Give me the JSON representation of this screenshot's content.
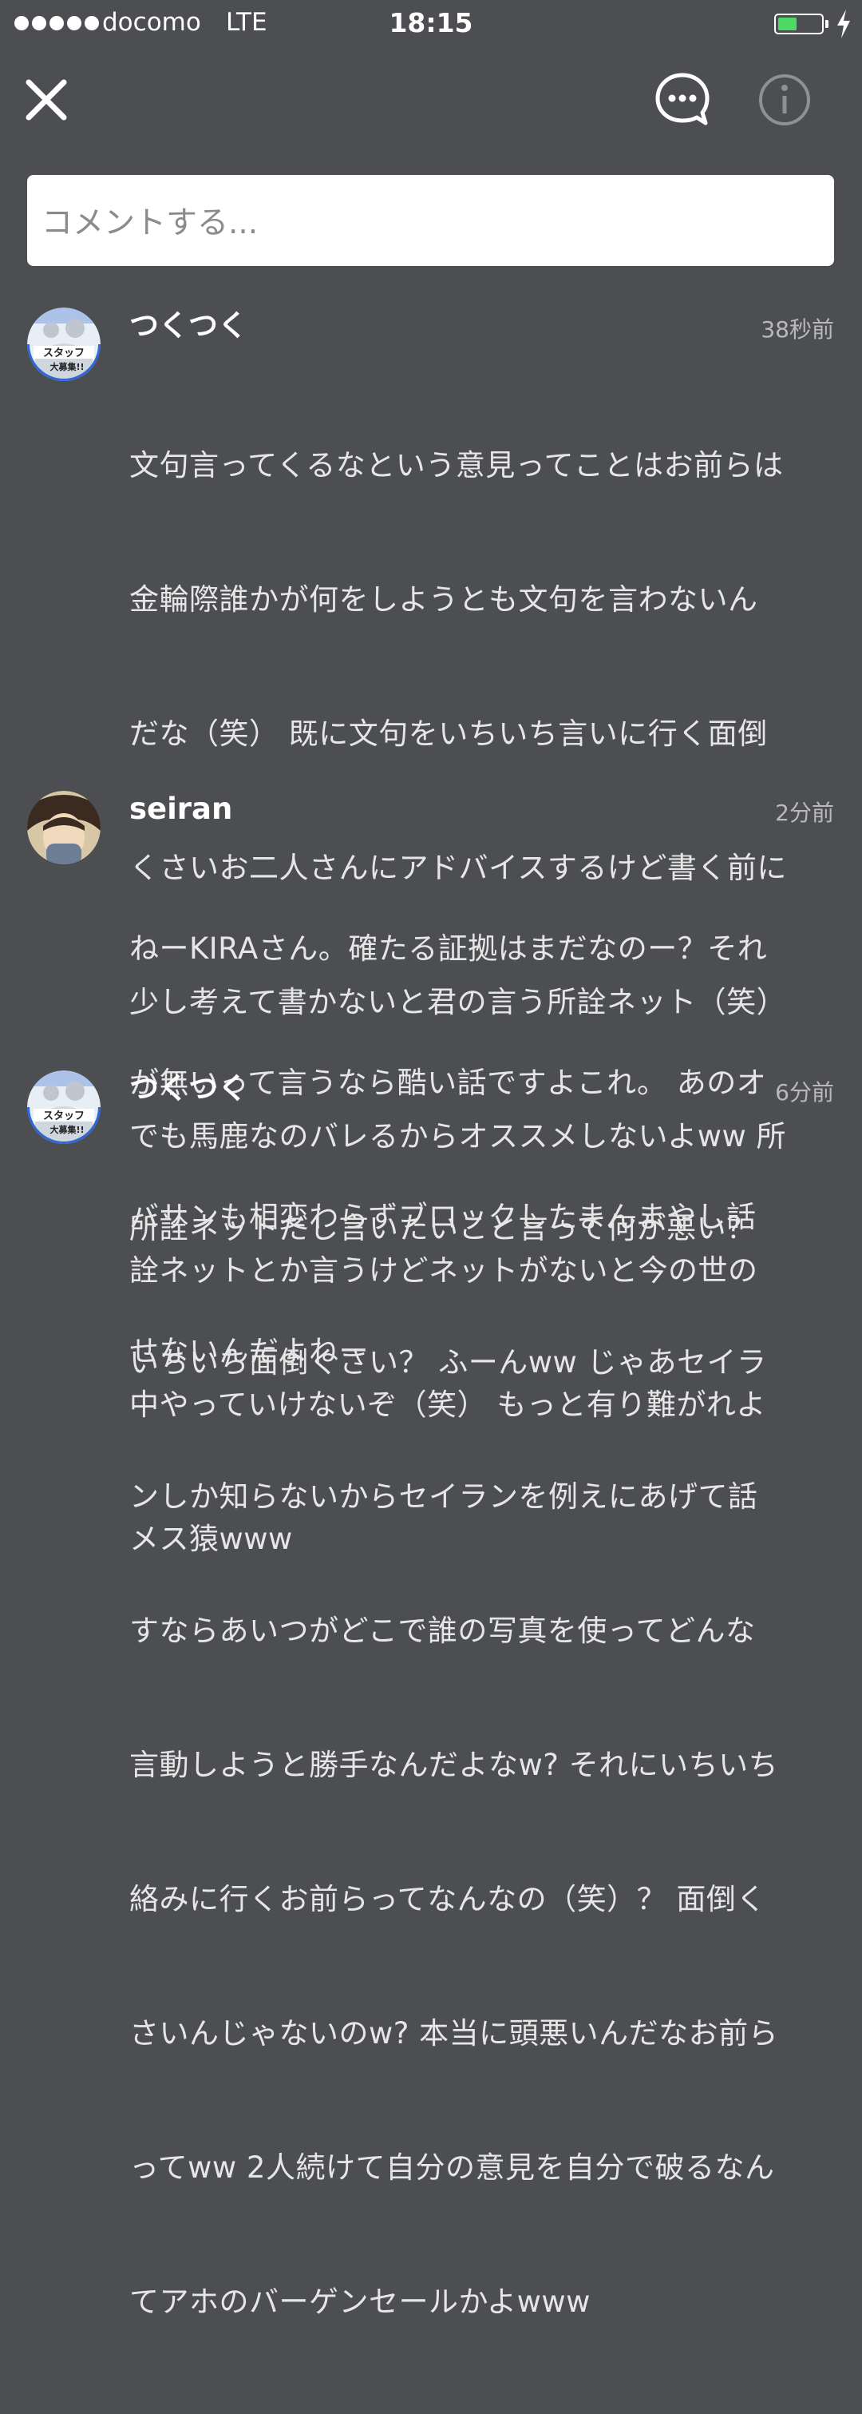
{
  "status_bar": {
    "carrier": "docomo",
    "network": "LTE",
    "time": "18:15",
    "battery_level": 0.45,
    "battery_color": "#4cd964"
  },
  "top_bar": {
    "close_icon": "close-icon",
    "chat_icon": "chat-bubble-icon",
    "info_icon": "info-icon"
  },
  "comment_input": {
    "placeholder": "コメントする..."
  },
  "comments": [
    {
      "username": "つくつく",
      "time": "38秒前",
      "lines": [
        "文句言ってくるなという意見ってことはお前らは",
        "金輪際誰かが何をしようとも文句を言わないん",
        "だな（笑） 既に文句をいちいち言いに行く面倒",
        "くさいお二人さんにアドバイスするけど書く前に",
        "少し考えて書かないと君の言う所詮ネット（笑）",
        "でも馬鹿なのバレるからオススメしないよww 所",
        "詮ネットとか言うけどネットがないと今の世の",
        "中やっていけないぞ（笑） もっと有り難がれよ",
        "メス猿www"
      ]
    },
    {
      "username": "seiran",
      "time": "2分前",
      "lines": [
        "ねーKIRAさん。確たる証拠はまだなのー？それ",
        "が無いって言うなら酷い話ですよこれ。 あのオ",
        "バサンも相変わらずブロックしたまんまやし話",
        "せないんだよねー"
      ]
    },
    {
      "username": "つくつく",
      "time": "6分前",
      "lines": [
        "所詮ネットだし言いたいこと言って何が悪い？",
        "いちいち面倒くさい？ ふーんww じゃあセイラ",
        "ンしか知らないからセイランを例えにあげて話",
        "すならあいつがどこで誰の写真を使ってどんな",
        "言動しようと勝手なんだよなw? それにいちいち",
        "絡みに行くお前らってなんなの（笑）？ 面倒く",
        "さいんじゃないのw? 本当に頭悪いんだなお前ら",
        "ってww 2人続けて自分の意見を自分で破るなん",
        "てアホのバーゲンセールかよwww"
      ]
    }
  ]
}
